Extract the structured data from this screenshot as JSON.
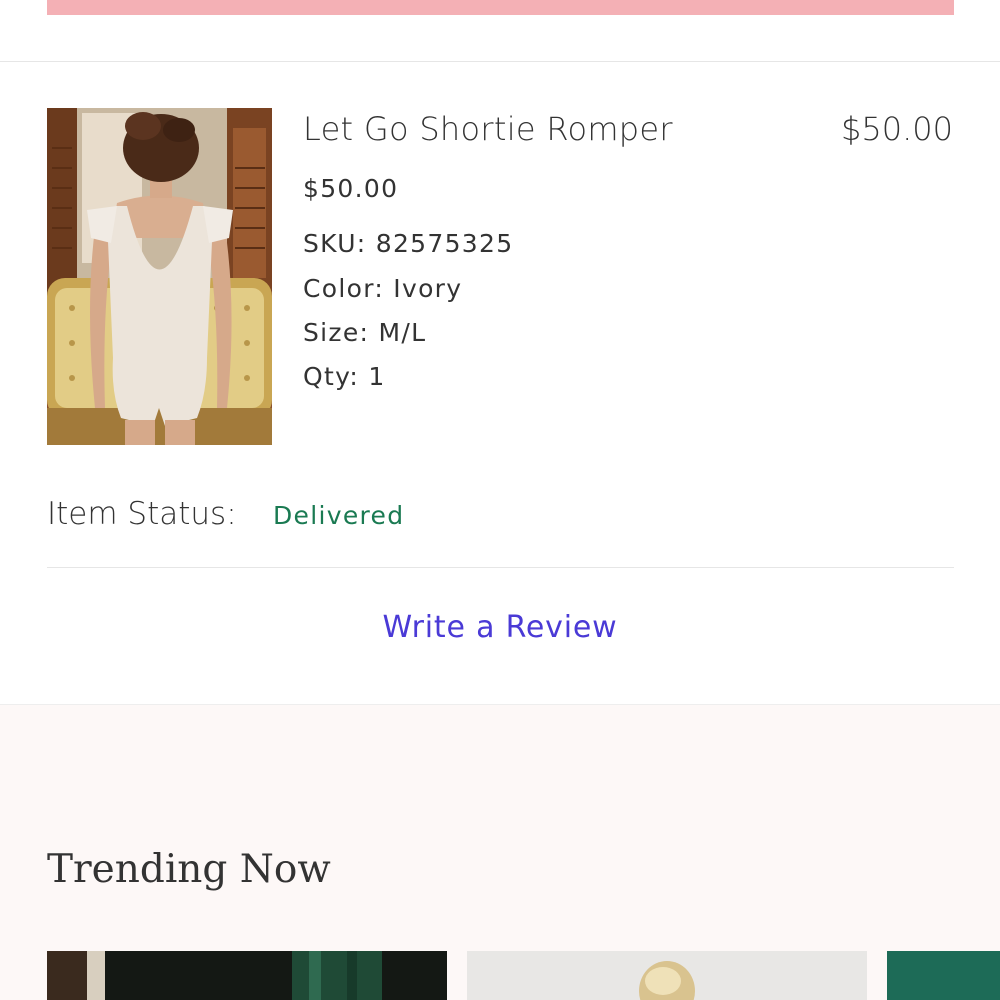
{
  "product": {
    "name": "Let Go Shortie Romper",
    "total": "$50.00",
    "price": "$50.00",
    "sku": "SKU: 82575325",
    "color": "Color: Ivory",
    "size": "Size: M/L",
    "qty": "Qty: 1"
  },
  "status": {
    "label": "Item Status:",
    "value": "Delivered"
  },
  "actions": {
    "review_label": "Write a Review"
  },
  "trending": {
    "title": "Trending Now"
  },
  "colors": {
    "banner": "#f4b0b5",
    "status_green": "#1a7a52",
    "link_purple": "#4a3ad6",
    "section_bg": "#fdf8f7"
  }
}
